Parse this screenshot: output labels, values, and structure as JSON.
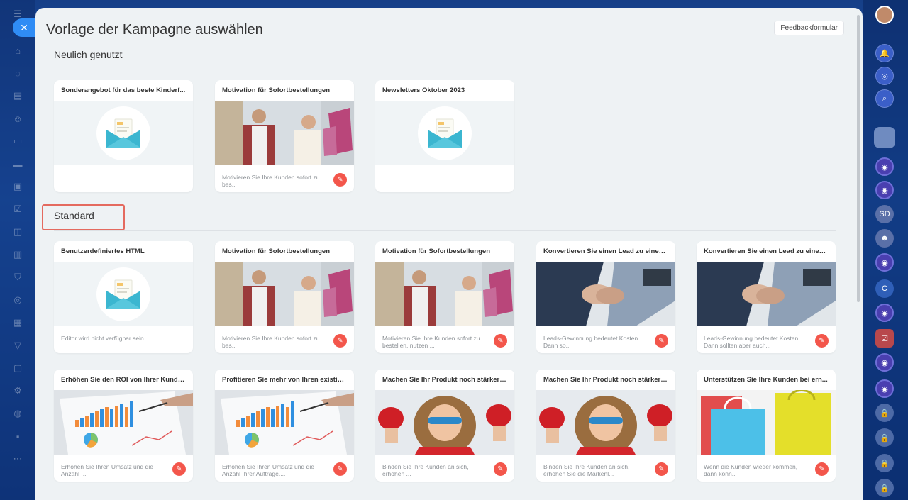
{
  "modal": {
    "title": "Vorlage der Kampagne auswählen",
    "feedback_label": "Feedbackformular",
    "close_symbol": "✕"
  },
  "sections": {
    "recent_title": "Neulich genutzt",
    "standard_title": "Standard"
  },
  "recent_cards": [
    {
      "title": "Sonderangebot für das beste Kinderf...",
      "image": "envelope-icon",
      "desc": ""
    },
    {
      "title": "Motivation für Sofortbestellungen",
      "image": "people-shopping-photo",
      "desc": "Motivieren Sie Ihre Kunden sofort zu bes..."
    },
    {
      "title": "Newsletters Oktober 2023",
      "image": "envelope-icon",
      "desc": ""
    }
  ],
  "standard_cards": [
    {
      "title": "Benutzerdefiniertes HTML",
      "image": "envelope-icon",
      "desc": "Editor wird nicht verfügbar sein...."
    },
    {
      "title": "Motivation für Sofortbestellungen",
      "image": "people-shopping-photo",
      "desc": "Motivieren Sie Ihre Kunden sofort zu bes..."
    },
    {
      "title": "Motivation für Sofortbestellungen",
      "image": "people-shopping-photo",
      "desc": "Motivieren Sie Ihre Kunden sofort zu bestellen, nutzen ..."
    },
    {
      "title": "Konvertieren Sie einen Lead zu einem...",
      "image": "handshake-photo",
      "desc": "Leads-Gewinnung bedeutet Kosten. Dann so..."
    },
    {
      "title": "Konvertieren Sie einen Lead zu einem...",
      "image": "handshake-photo",
      "desc": "Leads-Gewinnung bedeutet Kosten. Dann sollten aber auch..."
    },
    {
      "title": "Erhöhen Sie den ROI von Ihrer Kunde...",
      "image": "chart-photo",
      "desc": "Erhöhen Sie Ihren Umsatz und die Anzahl ..."
    },
    {
      "title": "Profitieren Sie mehr von Ihren existier...",
      "image": "chart-photo",
      "desc": "Erhöhen Sie Ihren Umsatz und die Anzahl Ihrer Aufträge...."
    },
    {
      "title": "Machen Sie Ihr Produkt noch stärker i...",
      "image": "hero-kid-photo",
      "desc": "Binden Sie Ihre Kunden an sich, erhöhen ..."
    },
    {
      "title": "Machen Sie Ihr Produkt noch stärker i...",
      "image": "hero-kid-photo",
      "desc": "Binden Sie Ihre Kunden an sich, erhöhen Sie die Markenl..."
    },
    {
      "title": "Unterstützen Sie Ihre Kunden bei ern...",
      "image": "shopping-bags-photo",
      "desc": "Wenn die Kunden wieder kommen, dann könn..."
    }
  ],
  "right_bar": {
    "sd_label": "SD",
    "c_label": "C"
  },
  "colors": {
    "accent": "#2f8cf5",
    "badge": "#f3564b",
    "highlight": "#e46a5f"
  }
}
